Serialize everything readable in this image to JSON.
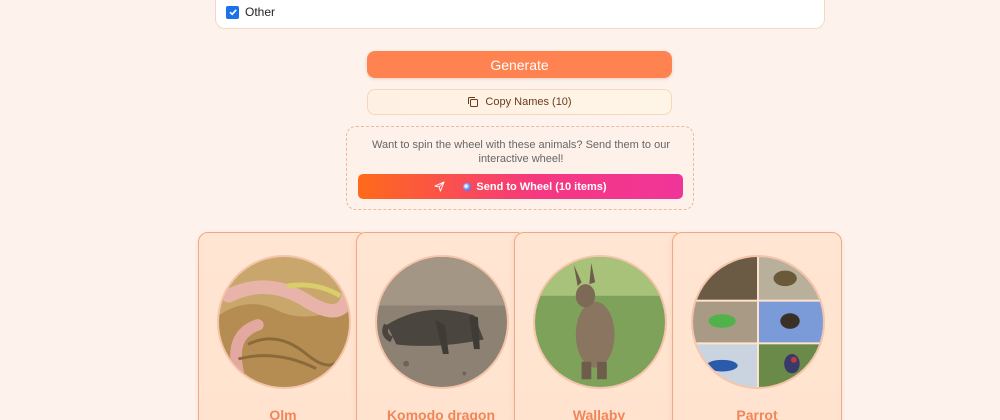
{
  "filters": {
    "other_label": "Other",
    "other_checked": true
  },
  "actions": {
    "generate_label": "Generate",
    "copy_label": "Copy Names (10)",
    "copy_icon": "copy-icon"
  },
  "wheel": {
    "prompt": "Want to spin the wheel with these animals? Send them to our interactive wheel!",
    "button_label": "Send to Wheel (10 items)",
    "send_icon": "send-icon"
  },
  "animals": [
    {
      "name": "Olm"
    },
    {
      "name": "Komodo dragon"
    },
    {
      "name": "Wallaby"
    },
    {
      "name": "Parrot"
    }
  ],
  "colors": {
    "accent": "#ff8350",
    "background": "#fdf3ec",
    "card_title": "#f0865a"
  }
}
